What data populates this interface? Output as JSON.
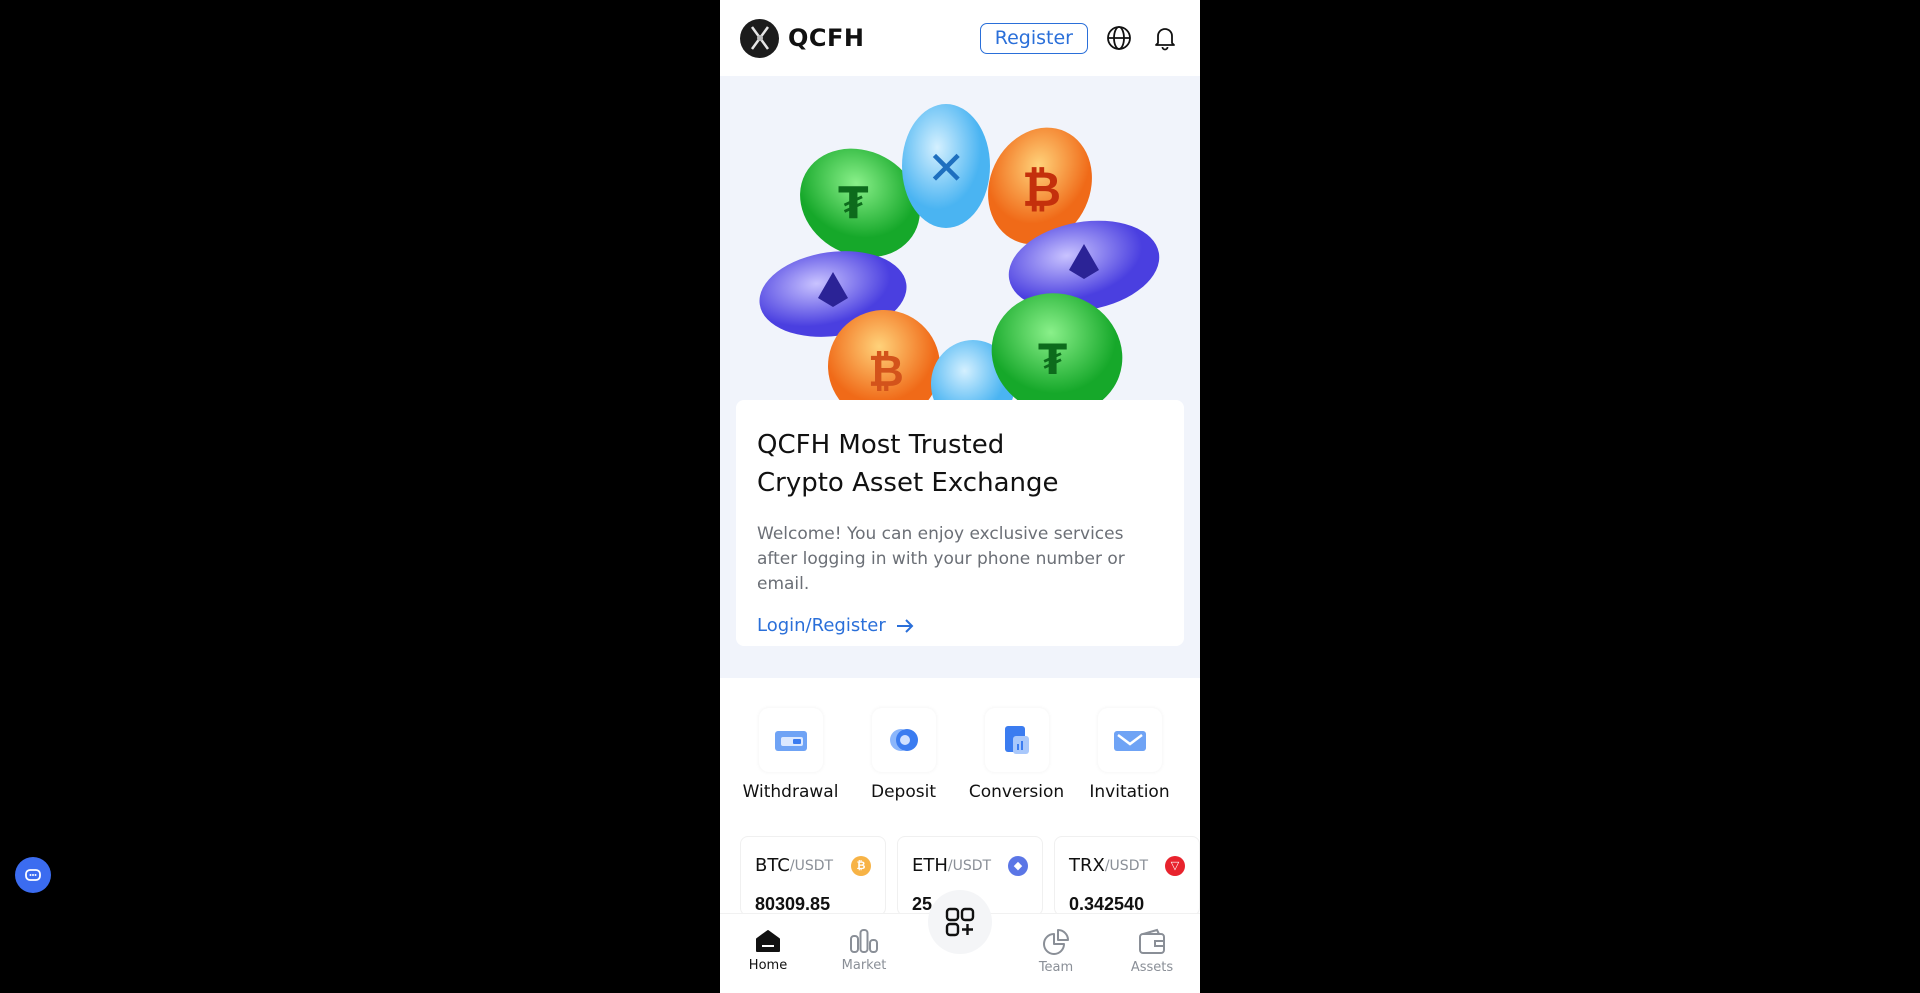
{
  "header": {
    "brand": "QCFH",
    "register_label": "Register"
  },
  "hero": {
    "title_line1": "QCFH Most Trusted",
    "title_line2": "Crypto Asset Exchange",
    "description": "Welcome! You can enjoy exclusive services after logging in with your phone number or email.",
    "link_label": "Login/Register"
  },
  "actions": [
    {
      "label": "Withdrawal",
      "icon": "withdrawal-icon"
    },
    {
      "label": "Deposit",
      "icon": "deposit-icon"
    },
    {
      "label": "Conversion",
      "icon": "conversion-icon"
    },
    {
      "label": "Invitation",
      "icon": "invitation-icon"
    }
  ],
  "tickers": [
    {
      "base": "BTC",
      "quote": "/USDT",
      "price": "80309.85",
      "color": "#f7b346"
    },
    {
      "base": "ETH",
      "quote": "/USDT",
      "price": "25",
      "color": "#5b76e6"
    },
    {
      "base": "TRX",
      "quote": "/USDT",
      "price": "0.342540",
      "color": "#e8232d"
    }
  ],
  "nav": [
    {
      "label": "Home",
      "icon": "home-icon",
      "active": true
    },
    {
      "label": "Market",
      "icon": "market-icon"
    },
    {
      "label": "Team",
      "icon": "team-icon"
    },
    {
      "label": "Assets",
      "icon": "wallet-icon"
    }
  ],
  "colors": {
    "accent": "#2a6fd9",
    "chat_button": "#3b6cf0"
  }
}
